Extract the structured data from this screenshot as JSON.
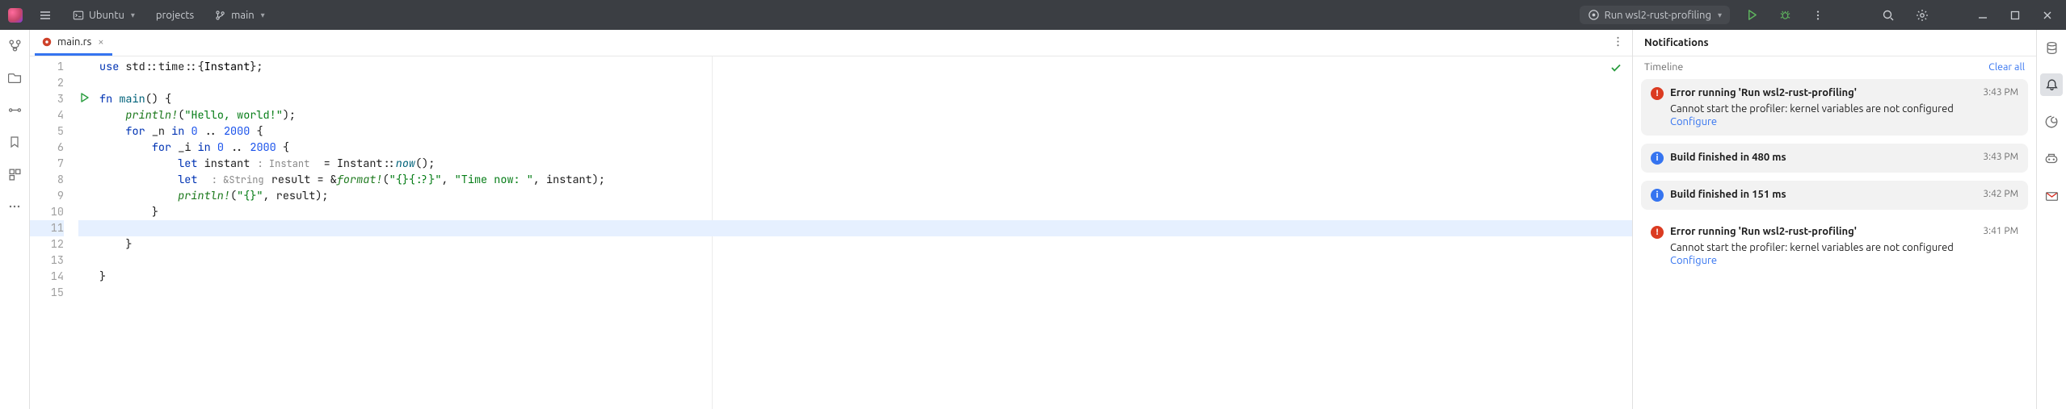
{
  "topbar": {
    "distro_label": "Ubuntu",
    "project_crumb": "projects",
    "branch_label": "main",
    "run_config_label": "Run wsl2-rust-profiling"
  },
  "tab": {
    "filename": "main.rs"
  },
  "code": {
    "lines": [
      {
        "n": "1"
      },
      {
        "n": "2"
      },
      {
        "n": "3"
      },
      {
        "n": "4"
      },
      {
        "n": "5"
      },
      {
        "n": "6"
      },
      {
        "n": "7"
      },
      {
        "n": "8"
      },
      {
        "n": "9"
      },
      {
        "n": "10"
      },
      {
        "n": "11"
      },
      {
        "n": "12"
      },
      {
        "n": "13"
      },
      {
        "n": "14"
      },
      {
        "n": "15"
      }
    ],
    "l1_kw": "use ",
    "l1_path": "std::time::",
    "l1_brace_open": "{",
    "l1_ty": "Instant",
    "l1_brace_close": "};",
    "l3_kw": "fn ",
    "l3_fn": "main",
    "l3_rest": "() {",
    "l4_mac": "println!",
    "l4_op": "(",
    "l4_str": "\"Hello, world!\"",
    "l4_cl": ");",
    "l5_kw": "for ",
    "l5_var": "_n ",
    "l5_in": "in ",
    "l5_a": "0",
    "l5_dots": " .. ",
    "l5_b": "2000",
    "l5_end": " {",
    "l6_kw": "for ",
    "l6_var": "_i ",
    "l6_in": "in ",
    "l6_a": "0",
    "l6_dots": " .. ",
    "l6_b": "2000",
    "l6_end": " {",
    "l7_kw": "let ",
    "l7_name": "instant",
    "l7_hint": " : Instant ",
    "l7_eq": " = ",
    "l7_ty": "Instant::",
    "l7_fn": "now",
    "l7_rest": "();",
    "l8_kw": "let ",
    "l8_hint": " : &String ",
    "l8_name": "result = &",
    "l8_mac": "format!",
    "l8_op": "(",
    "l8_s1": "\"{}{:?}\"",
    "l8_c": ", ",
    "l8_s2": "\"Time now: \"",
    "l8_rest": ", instant);",
    "l9_mac": "println!",
    "l9_op": "(",
    "l9_str": "\"{}\"",
    "l9_rest": ", result);",
    "l10": "}",
    "l12": "}",
    "l14": "}"
  },
  "notifications": {
    "title": "Notifications",
    "timeline_label": "Timeline",
    "clear_all_label": "Clear all",
    "items": [
      {
        "kind": "error",
        "bg": true,
        "title": "Error running 'Run wsl2-rust-profiling'",
        "time": "3:43 PM",
        "message": "Cannot start the profiler: kernel variables are not configured",
        "link": "Configure"
      },
      {
        "kind": "info",
        "bg": true,
        "title": "Build finished in 480 ms",
        "time": "3:43 PM"
      },
      {
        "kind": "info",
        "bg": true,
        "title": "Build finished in 151 ms",
        "time": "3:42 PM"
      },
      {
        "kind": "error",
        "bg": false,
        "title": "Error running 'Run wsl2-rust-profiling'",
        "time": "3:41 PM",
        "message": "Cannot start the profiler: kernel variables are not configured",
        "link": "Configure"
      }
    ]
  }
}
